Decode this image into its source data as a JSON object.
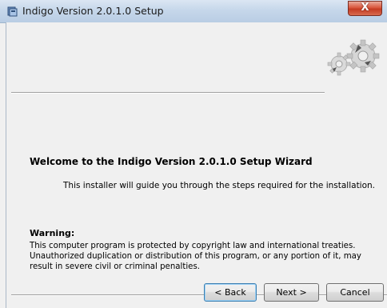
{
  "window": {
    "title": "Indigo Version 2.0.1.0 Setup",
    "close_glyph": "X"
  },
  "content": {
    "welcome_title": "Welcome to the Indigo Version 2.0.1.0 Setup Wizard",
    "intro_text": "This installer will guide you through the steps required for the installation.",
    "warning_title": "Warning:",
    "warning_text": "This computer program is protected by copyright law and international treaties. Unauthorized duplication or distribution of this program, or any portion of it, may result in severe civil or criminal penalties."
  },
  "buttons": {
    "back_label": "< Back",
    "next_label": "Next >",
    "cancel_label": "Cancel"
  },
  "icons": {
    "app": "installer-icon",
    "header": "gears-icon",
    "close": "close-icon"
  },
  "colors": {
    "titlebar": "#c6d7ea",
    "close_button": "#d9563d",
    "background": "#f0f0f0"
  }
}
